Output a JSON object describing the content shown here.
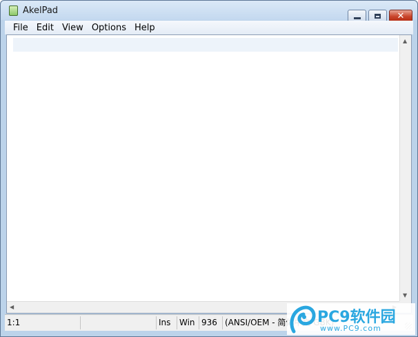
{
  "window": {
    "title": "AkelPad"
  },
  "menu": [
    {
      "label": "File"
    },
    {
      "label": "Edit"
    },
    {
      "label": "View"
    },
    {
      "label": "Options"
    },
    {
      "label": "Help"
    }
  ],
  "editor": {
    "content": ""
  },
  "status": {
    "position": "1:1",
    "modified": "",
    "insert_mode": "Ins",
    "newline": "Win",
    "codepage": "936",
    "encoding": "(ANSI/OEM - 简体中文 GBK)"
  },
  "watermark": {
    "text": "PC9软件园",
    "url": "www.PC9.com"
  },
  "icons": {
    "app": "akelpad-icon",
    "minimize": "minimize-icon",
    "maximize": "maximize-icon",
    "close": "close-icon"
  }
}
